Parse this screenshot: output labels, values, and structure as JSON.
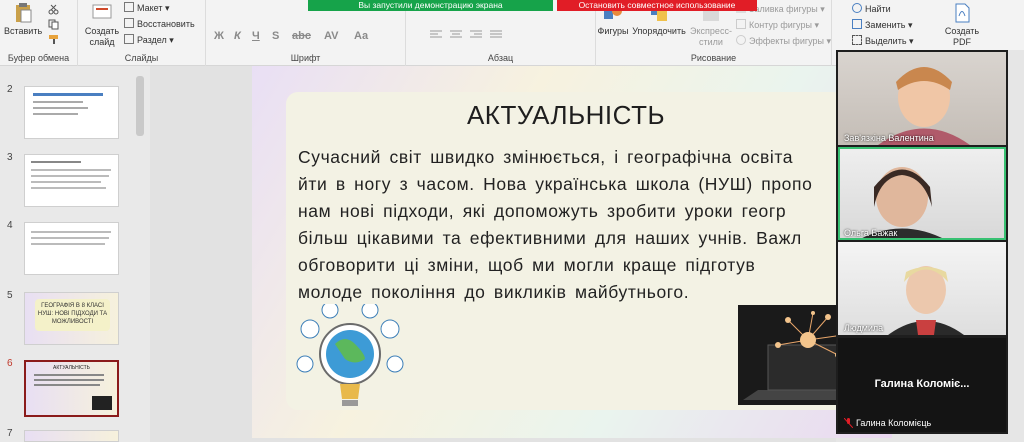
{
  "share": {
    "started_text": "Вы запустили демонстрацию экрана",
    "stop_text": "Остановить совместное использование"
  },
  "ribbon": {
    "paste": "Вставить",
    "clipboard_group": "Буфер обмена",
    "new_slide": "Создать слайд",
    "layout": "Макет",
    "reset": "Восстановить",
    "section": "Раздел",
    "slides_group": "Слайды",
    "font_group": "Шрифт",
    "paragraph_group": "Абзац",
    "shapes": "Фигуры",
    "arrange": "Упорядочить",
    "express_styles": "Экспресс-стили",
    "fill": "Заливка фигуры",
    "outline": "Контур фигуры",
    "effects": "Эффекты фигуры",
    "drawing_group": "Рисование",
    "find": "Найти",
    "replace": "Заменить",
    "select": "Выделить",
    "create_pdf": "Создать PDF"
  },
  "thumbnails": [
    {
      "num": "2"
    },
    {
      "num": "3"
    },
    {
      "num": "4"
    },
    {
      "num": "5",
      "text": "ГЕОГРАФІЯ В 8 КЛАСІ НУШ: НОВІ ПІДХОДИ ТА МОЖЛИВОСТІ"
    },
    {
      "num": "6",
      "text": "АКТУАЛЬНІСТЬ"
    },
    {
      "num": "7"
    }
  ],
  "slide": {
    "title": "АКТУАЛЬНІСТЬ",
    "line1": "Сучасний світ швидко змінюється, і географічна освіта",
    "line2": "йти в ногу з часом. Нова українська школа (НУШ) пропо",
    "line3": "нам нові підходи, які допоможуть зробити уроки геогр",
    "line4": "більш цікавими та ефективними для наших учнів. Важл",
    "line5": "обговорити ці зміни, щоб ми могли краще підготув",
    "line6": "молоде покоління до викликів майбутнього."
  },
  "participants": [
    {
      "name": "Зав'язкіна Валентина"
    },
    {
      "name": "Ольга Бажак"
    },
    {
      "name": "Людмила"
    }
  ],
  "camera_off": {
    "big_name": "Галина  Коломіє...",
    "small_name": "Галина Коломієць"
  }
}
